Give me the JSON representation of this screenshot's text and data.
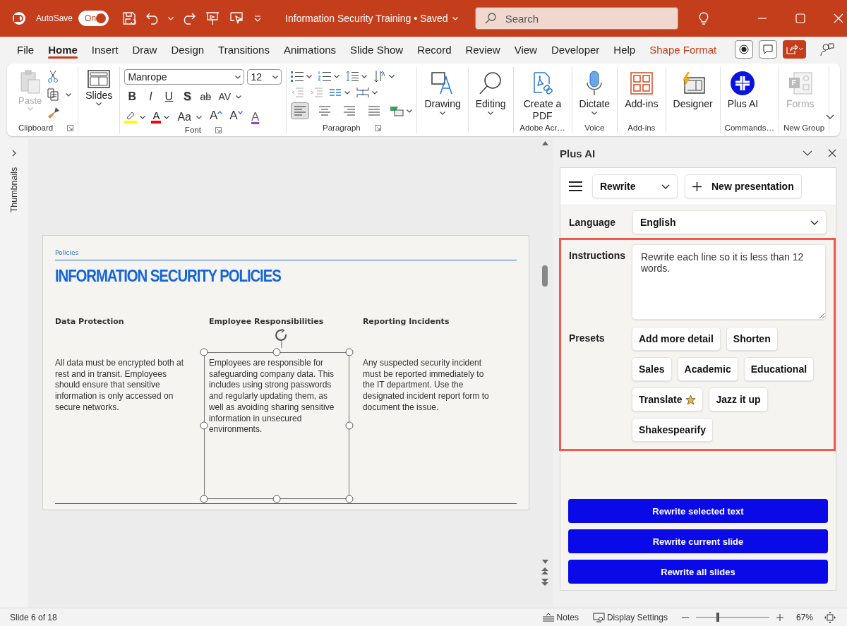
{
  "title_bar": {
    "autosave_label": "AutoSave",
    "autosave_toggle": {
      "label": "On",
      "on": true
    },
    "document_title": "Information Security Training • Saved",
    "search": {
      "placeholder": "Search"
    }
  },
  "menu_tabs": [
    {
      "label": "File",
      "selected": false,
      "kind": "standard"
    },
    {
      "label": "Home",
      "selected": true,
      "kind": "standard"
    },
    {
      "label": "Insert",
      "selected": false,
      "kind": "standard"
    },
    {
      "label": "Draw",
      "selected": false,
      "kind": "standard"
    },
    {
      "label": "Design",
      "selected": false,
      "kind": "standard"
    },
    {
      "label": "Transitions",
      "selected": false,
      "kind": "standard"
    },
    {
      "label": "Animations",
      "selected": false,
      "kind": "standard"
    },
    {
      "label": "Slide Show",
      "selected": false,
      "kind": "standard"
    },
    {
      "label": "Record",
      "selected": false,
      "kind": "standard"
    },
    {
      "label": "Review",
      "selected": false,
      "kind": "standard"
    },
    {
      "label": "View",
      "selected": false,
      "kind": "standard"
    },
    {
      "label": "Developer",
      "selected": false,
      "kind": "standard"
    },
    {
      "label": "Help",
      "selected": false,
      "kind": "standard"
    },
    {
      "label": "Shape Format",
      "selected": false,
      "kind": "contextual"
    }
  ],
  "ribbon": {
    "clipboard": {
      "paste": "Paste",
      "label": "Clipboard"
    },
    "slides": {
      "label": "Slides"
    },
    "font": {
      "family": "Manrope",
      "size": "12",
      "label": "Font",
      "format_buttons": [
        {
          "label": "B",
          "kind": "bold"
        },
        {
          "label": "I",
          "kind": "italic"
        },
        {
          "label": "U",
          "kind": "underline"
        },
        {
          "label": "S",
          "kind": "shadow"
        },
        {
          "label": "ab",
          "kind": "strike"
        },
        {
          "label": "AV",
          "kind": "spacing"
        }
      ],
      "color_buttons": [
        {
          "kind": "highlight",
          "color": "#ffff00"
        },
        {
          "label": "A",
          "kind": "font-color",
          "color": "#ff0000"
        },
        {
          "label": "Aa",
          "kind": "case"
        },
        {
          "label": "A",
          "kind": "grow"
        },
        {
          "label": "A",
          "kind": "shrink"
        },
        {
          "label": "A",
          "kind": "clear"
        }
      ]
    },
    "paragraph": {
      "label": "Paragraph",
      "alignment": [
        {
          "kind": "left",
          "selected": true
        },
        {
          "kind": "center",
          "selected": false
        },
        {
          "kind": "right",
          "selected": false
        },
        {
          "kind": "justify",
          "selected": false
        }
      ]
    },
    "groups": [
      {
        "buttons": [
          {
            "label": "Drawing",
            "kind": "drawing",
            "dropdown": true,
            "disabled": false
          }
        ]
      },
      {
        "buttons": [
          {
            "label": "Editing",
            "kind": "search",
            "dropdown": true,
            "disabled": false
          }
        ]
      },
      {
        "label": "Adobe Acr…",
        "buttons": [
          {
            "label": "Create a PDF",
            "kind": "pdf",
            "dropdown": false,
            "disabled": false
          }
        ]
      },
      {
        "label": "Voice",
        "buttons": [
          {
            "label": "Dictate",
            "kind": "mic",
            "dropdown": true,
            "disabled": false
          }
        ]
      },
      {
        "label": "Add-ins",
        "buttons": [
          {
            "label": "Add-ins",
            "kind": "grid",
            "dropdown": false,
            "disabled": false
          }
        ]
      },
      {
        "buttons": [
          {
            "label": "Designer",
            "kind": "designer",
            "dropdown": false,
            "disabled": false
          }
        ]
      },
      {
        "label": "Commands…",
        "buttons": [
          {
            "label": "Plus AI",
            "kind": "plus",
            "dropdown": false,
            "disabled": false
          }
        ]
      },
      {
        "label": "New Group",
        "buttons": [
          {
            "label": "Forms",
            "kind": "forms",
            "dropdown": false,
            "disabled": true
          }
        ]
      }
    ]
  },
  "thumbnails_pane": {
    "label": "Thumbnails"
  },
  "slide": {
    "kicker": "Policies",
    "title": "INFORMATION SECURITY POLICIES",
    "columns": [
      {
        "heading": "Data Protection",
        "body": "All data must be encrypted both at rest and in transit. Employees should ensure that sensitive information is only accessed on secure networks.",
        "selected": false
      },
      {
        "heading": "Employee Responsibilities",
        "body": "Employees are responsible for safeguarding company data. This includes using strong passwords and regularly updating them, as well as avoiding sharing sensitive information in unsecured environments.",
        "selected": true
      },
      {
        "heading": "Reporting Incidents",
        "body": "Any suspected security incident must be reported immediately to the IT department. Use the designated incident report form to document the issue.",
        "selected": false
      }
    ]
  },
  "plus_ai_panel": {
    "title": "Plus AI",
    "mode": "Rewrite",
    "new_button": "New presentation",
    "language": {
      "label": "Language",
      "value": "English"
    },
    "instructions": {
      "label": "Instructions",
      "value": "Rewrite each line so it is less than 12 words."
    },
    "presets": {
      "label": "Presets",
      "items": [
        {
          "label": "Add more detail",
          "kind": "plain"
        },
        {
          "label": "Shorten",
          "kind": "plain"
        },
        {
          "label": "Sales",
          "kind": "plain"
        },
        {
          "label": "Academic",
          "kind": "plain"
        },
        {
          "label": "Educational",
          "kind": "plain"
        },
        {
          "label": "Translate",
          "kind": "premium"
        },
        {
          "label": "Jazz it up",
          "kind": "plain"
        },
        {
          "label": "Shakespearify",
          "kind": "plain"
        }
      ]
    },
    "actions": [
      "Rewrite selected text",
      "Rewrite current slide",
      "Rewrite all slides"
    ]
  },
  "status_bar": {
    "slide_counter": "Slide 6 of 18",
    "notes": "Notes",
    "display_settings": "Display Settings",
    "zoom": {
      "level": 0.3,
      "reading": "67%"
    }
  }
}
